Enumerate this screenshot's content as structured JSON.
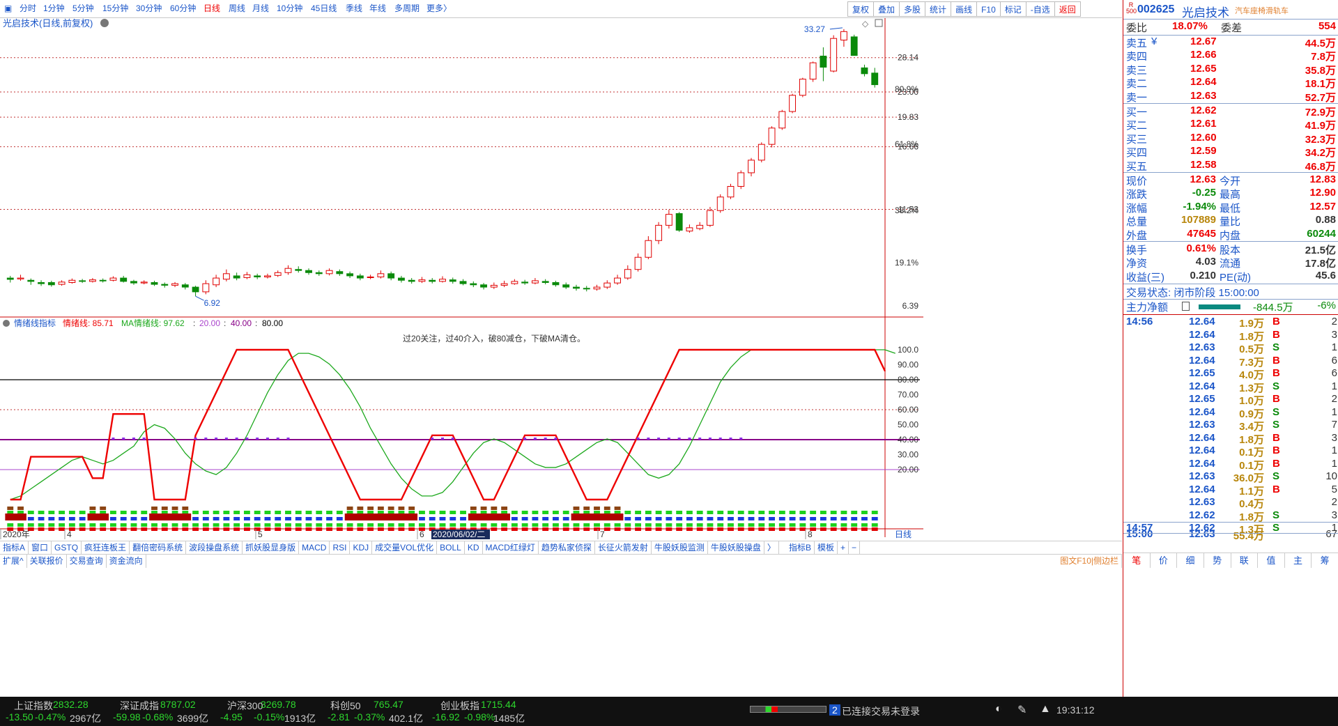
{
  "periods": [
    "分时",
    "1分钟",
    "5分钟",
    "15分钟",
    "30分钟",
    "60分钟",
    "日线",
    "周线",
    "月线",
    "10分钟",
    "45日线",
    "季线",
    "年线",
    "多周期",
    "更多〉"
  ],
  "active_period": "日线",
  "toolbar": [
    "复权",
    "叠加",
    "多股",
    "统计",
    "画线",
    "F10",
    "标记",
    "-自选",
    "返回"
  ],
  "chart_title": "光启技术(日线,前复权)",
  "price_axis": [
    "28.14",
    "23.00",
    "19.83",
    "16.66",
    "11.53",
    "6.39"
  ],
  "pct_axis": [
    "80.9%",
    "61.8%",
    "38.2%",
    "19.1%"
  ],
  "max_label": "33.27",
  "min_label": "6.92",
  "indicator": {
    "name": "情绪线指标",
    "l1": "情绪线: 85.71",
    "l2": "MA情绪线: 97.62",
    "v20": "20.00",
    "v40": "40.00",
    "v80": "80.00",
    "note": "过20关注，过40介入，破80减仓，下破MA清仓。"
  },
  "ind_axis": [
    "100.0",
    "90.00",
    "80.00",
    "70.00",
    "60.00",
    "50.00",
    "40.00",
    "30.00",
    "20.00"
  ],
  "date_axis": [
    "2020年",
    "4",
    "5",
    "6",
    "7",
    "8"
  ],
  "date_cursor": "2020/06/02/二",
  "date_axis_right": "日线",
  "chart_data": {
    "type": "candlestick",
    "max": 33.27,
    "min": 6.92,
    "ylim_price": [
      6.39,
      33.27
    ],
    "candles": [
      {
        "o": 7.7,
        "c": 7.64,
        "h": 7.8,
        "l": 7.5
      },
      {
        "o": 7.66,
        "c": 7.7,
        "h": 7.85,
        "l": 7.58
      },
      {
        "o": 7.6,
        "c": 7.55,
        "h": 7.68,
        "l": 7.4
      },
      {
        "o": 7.5,
        "c": 7.45,
        "h": 7.6,
        "l": 7.35
      },
      {
        "o": 7.5,
        "c": 7.4,
        "h": 7.58,
        "l": 7.32
      },
      {
        "o": 7.42,
        "c": 7.52,
        "h": 7.6,
        "l": 7.36
      },
      {
        "o": 7.5,
        "c": 7.6,
        "h": 7.68,
        "l": 7.45
      },
      {
        "o": 7.58,
        "c": 7.55,
        "h": 7.66,
        "l": 7.48
      },
      {
        "o": 7.55,
        "c": 7.62,
        "h": 7.7,
        "l": 7.5
      },
      {
        "o": 7.6,
        "c": 7.58,
        "h": 7.68,
        "l": 7.5
      },
      {
        "o": 7.6,
        "c": 7.7,
        "h": 7.78,
        "l": 7.55
      },
      {
        "o": 7.7,
        "c": 7.55,
        "h": 7.8,
        "l": 7.5
      },
      {
        "o": 7.55,
        "c": 7.48,
        "h": 7.62,
        "l": 7.4
      },
      {
        "o": 7.48,
        "c": 7.52,
        "h": 7.6,
        "l": 7.42
      },
      {
        "o": 7.5,
        "c": 7.42,
        "h": 7.58,
        "l": 7.35
      },
      {
        "o": 7.42,
        "c": 7.38,
        "h": 7.5,
        "l": 7.28
      },
      {
        "o": 7.38,
        "c": 7.45,
        "h": 7.52,
        "l": 7.3
      },
      {
        "o": 7.4,
        "c": 7.3,
        "h": 7.48,
        "l": 7.2
      },
      {
        "o": 7.3,
        "c": 7.1,
        "h": 7.36,
        "l": 6.92
      },
      {
        "o": 7.1,
        "c": 7.45,
        "h": 7.6,
        "l": 7.0
      },
      {
        "o": 7.4,
        "c": 7.7,
        "h": 7.85,
        "l": 7.3
      },
      {
        "o": 7.65,
        "c": 7.9,
        "h": 8.1,
        "l": 7.55
      },
      {
        "o": 7.8,
        "c": 7.7,
        "h": 7.95,
        "l": 7.6
      },
      {
        "o": 7.72,
        "c": 7.85,
        "h": 7.98,
        "l": 7.65
      },
      {
        "o": 7.8,
        "c": 7.75,
        "h": 7.9,
        "l": 7.65
      },
      {
        "o": 7.75,
        "c": 7.8,
        "h": 7.9,
        "l": 7.68
      },
      {
        "o": 7.82,
        "c": 7.95,
        "h": 8.05,
        "l": 7.75
      },
      {
        "o": 7.95,
        "c": 8.15,
        "h": 8.3,
        "l": 7.85
      },
      {
        "o": 8.1,
        "c": 8.05,
        "h": 8.25,
        "l": 7.95
      },
      {
        "o": 8.05,
        "c": 7.95,
        "h": 8.15,
        "l": 7.85
      },
      {
        "o": 7.95,
        "c": 7.9,
        "h": 8.05,
        "l": 7.8
      },
      {
        "o": 7.9,
        "c": 8.05,
        "h": 8.15,
        "l": 7.82
      },
      {
        "o": 8.0,
        "c": 7.9,
        "h": 8.1,
        "l": 7.8
      },
      {
        "o": 7.9,
        "c": 7.8,
        "h": 8.0,
        "l": 7.7
      },
      {
        "o": 7.8,
        "c": 7.7,
        "h": 7.9,
        "l": 7.6
      },
      {
        "o": 7.72,
        "c": 7.75,
        "h": 7.85,
        "l": 7.65
      },
      {
        "o": 7.75,
        "c": 7.9,
        "h": 8.05,
        "l": 7.68
      },
      {
        "o": 7.9,
        "c": 7.7,
        "h": 8.0,
        "l": 7.6
      },
      {
        "o": 7.7,
        "c": 7.6,
        "h": 7.8,
        "l": 7.5
      },
      {
        "o": 7.6,
        "c": 7.55,
        "h": 7.7,
        "l": 7.45
      },
      {
        "o": 7.55,
        "c": 7.62,
        "h": 7.75,
        "l": 7.48
      },
      {
        "o": 7.6,
        "c": 7.55,
        "h": 7.7,
        "l": 7.46
      },
      {
        "o": 7.55,
        "c": 7.65,
        "h": 7.78,
        "l": 7.5
      },
      {
        "o": 7.62,
        "c": 7.55,
        "h": 7.72,
        "l": 7.45
      },
      {
        "o": 7.55,
        "c": 7.45,
        "h": 7.65,
        "l": 7.38
      },
      {
        "o": 7.45,
        "c": 7.4,
        "h": 7.55,
        "l": 7.3
      },
      {
        "o": 7.4,
        "c": 7.3,
        "h": 7.48,
        "l": 7.2
      },
      {
        "o": 7.3,
        "c": 7.38,
        "h": 7.5,
        "l": 7.22
      },
      {
        "o": 7.38,
        "c": 7.45,
        "h": 7.58,
        "l": 7.3
      },
      {
        "o": 7.45,
        "c": 7.55,
        "h": 7.65,
        "l": 7.4
      },
      {
        "o": 7.52,
        "c": 7.48,
        "h": 7.62,
        "l": 7.4
      },
      {
        "o": 7.48,
        "c": 7.58,
        "h": 7.7,
        "l": 7.42
      },
      {
        "o": 7.55,
        "c": 7.5,
        "h": 7.65,
        "l": 7.42
      },
      {
        "o": 7.5,
        "c": 7.4,
        "h": 7.58,
        "l": 7.32
      },
      {
        "o": 7.4,
        "c": 7.3,
        "h": 7.5,
        "l": 7.22
      },
      {
        "o": 7.3,
        "c": 7.25,
        "h": 7.4,
        "l": 7.15
      },
      {
        "o": 7.25,
        "c": 7.22,
        "h": 7.35,
        "l": 7.12
      },
      {
        "o": 7.22,
        "c": 7.3,
        "h": 7.4,
        "l": 7.15
      },
      {
        "o": 7.3,
        "c": 7.48,
        "h": 7.6,
        "l": 7.22
      },
      {
        "o": 7.48,
        "c": 7.7,
        "h": 7.85,
        "l": 7.4
      },
      {
        "o": 7.7,
        "c": 8.1,
        "h": 8.3,
        "l": 7.62
      },
      {
        "o": 8.1,
        "c": 8.7,
        "h": 8.9,
        "l": 8.0
      },
      {
        "o": 8.7,
        "c": 9.6,
        "h": 9.85,
        "l": 8.6
      },
      {
        "o": 9.6,
        "c": 10.5,
        "h": 10.7,
        "l": 9.4
      },
      {
        "o": 10.5,
        "c": 11.2,
        "h": 11.5,
        "l": 10.3
      },
      {
        "o": 11.25,
        "c": 10.2,
        "h": 11.35,
        "l": 10.1
      },
      {
        "o": 10.15,
        "c": 10.35,
        "h": 10.55,
        "l": 10.05
      },
      {
        "o": 10.3,
        "c": 10.5,
        "h": 10.7,
        "l": 10.2
      },
      {
        "o": 10.5,
        "c": 11.45,
        "h": 11.7,
        "l": 10.4
      },
      {
        "o": 11.45,
        "c": 12.4,
        "h": 12.6,
        "l": 11.3
      },
      {
        "o": 12.4,
        "c": 13.2,
        "h": 13.4,
        "l": 12.25
      },
      {
        "o": 13.2,
        "c": 14.3,
        "h": 14.5,
        "l": 13.0
      },
      {
        "o": 14.3,
        "c": 15.4,
        "h": 15.6,
        "l": 14.0
      },
      {
        "o": 15.4,
        "c": 16.9,
        "h": 17.1,
        "l": 15.2
      },
      {
        "o": 16.9,
        "c": 18.6,
        "h": 18.8,
        "l": 16.6
      },
      {
        "o": 18.6,
        "c": 20.5,
        "h": 20.7,
        "l": 18.4
      },
      {
        "o": 20.5,
        "c": 22.55,
        "h": 22.75,
        "l": 20.3
      },
      {
        "o": 22.55,
        "c": 24.8,
        "h": 25.0,
        "l": 22.3
      },
      {
        "o": 24.8,
        "c": 27.3,
        "h": 27.5,
        "l": 24.4
      },
      {
        "o": 28.4,
        "c": 26.6,
        "h": 29.9,
        "l": 24.5
      },
      {
        "o": 26.0,
        "c": 31.5,
        "h": 32.1,
        "l": 25.8
      },
      {
        "o": 31.2,
        "c": 32.8,
        "h": 33.27,
        "l": 30.0
      },
      {
        "o": 31.8,
        "c": 28.5,
        "h": 32.2,
        "l": 28.5
      },
      {
        "o": 26.5,
        "c": 25.6,
        "h": 27.0,
        "l": 25.2
      },
      {
        "o": 25.7,
        "c": 24.0,
        "h": 26.5,
        "l": 23.6
      }
    ],
    "emotion": [
      0,
      0,
      28.57,
      28.57,
      28.57,
      28.57,
      28.57,
      28.57,
      14.29,
      14.29,
      57.14,
      57.14,
      57.14,
      57.14,
      0,
      0,
      0,
      0,
      42.86,
      57.14,
      71.43,
      85.71,
      100,
      100,
      100,
      100,
      100,
      100,
      85.71,
      71.43,
      57.14,
      42.86,
      28.57,
      14.29,
      0,
      0,
      0,
      0,
      0,
      14.29,
      28.57,
      42.86,
      42.86,
      42.86,
      28.57,
      14.29,
      0,
      0,
      14.29,
      28.57,
      42.86,
      42.86,
      42.86,
      42.86,
      28.57,
      14.29,
      0,
      0,
      0,
      14.29,
      28.57,
      42.86,
      57.14,
      71.43,
      85.71,
      100,
      100,
      100,
      100,
      100,
      100,
      100,
      100,
      100,
      100,
      100,
      100,
      100,
      100,
      100,
      100,
      100,
      100,
      100,
      100,
      85.71
    ],
    "ma_emotion": [
      0,
      2.38,
      7.14,
      11.9,
      16.67,
      21.43,
      26.19,
      28.57,
      26.19,
      23.81,
      26.19,
      30.95,
      35.71,
      45.24,
      50,
      47.62,
      40.48,
      30.95,
      23.81,
      19.05,
      16.67,
      21.43,
      30.95,
      42.86,
      57.14,
      71.43,
      83.33,
      92.86,
      97.62,
      97.62,
      95.24,
      90.48,
      83.33,
      73.81,
      61.9,
      47.62,
      35.71,
      23.81,
      14.29,
      7.14,
      2.38,
      2.38,
      4.76,
      11.9,
      21.43,
      30.95,
      38.1,
      40.48,
      38.1,
      33.33,
      28.57,
      23.81,
      21.43,
      21.43,
      23.81,
      28.57,
      33.33,
      38.1,
      40.48,
      38.1,
      30.95,
      23.81,
      16.67,
      14.29,
      16.67,
      23.81,
      35.71,
      50,
      64.29,
      78.57,
      88.1,
      95.24,
      100,
      100,
      100,
      100,
      100,
      100,
      100,
      100,
      100,
      100,
      100,
      100,
      100,
      100,
      97.62
    ]
  },
  "sub_row1": [
    "指标A",
    "窗口",
    "GSTQ",
    "疯狂连板王",
    "翻倍密码系统",
    "波段操盘系统",
    "抓妖股显身版",
    "MACD",
    "RSI",
    "KDJ",
    "成交量VOL优化",
    "BOLL",
    "KD",
    "MACD红绿灯",
    "趋势私家侦探",
    "长征火箭发射",
    "牛股妖股监测",
    "牛股妖股操盘",
    "〉",
    "指标B",
    "模板",
    "+",
    "−"
  ],
  "sub_row2": [
    "扩展^",
    "关联报价",
    "交易查询",
    "资金流向"
  ],
  "sub_row2_right": "图文F10|侧边栏",
  "rbottom_tabs": [
    "笔",
    "价",
    "细",
    "势",
    "联",
    "值",
    "主",
    "筹"
  ],
  "stock": {
    "badge": "R",
    "badge2": "500",
    "code": "002625",
    "name": "光启技术",
    "tag": "汽车座椅滑轨车"
  },
  "ratio": {
    "label1": "委比",
    "v1": "18.07%",
    "label2": "委差",
    "v2": "554"
  },
  "asks": [
    {
      "l": "卖五",
      "p": "12.67",
      "v": "44.5万"
    },
    {
      "l": "卖四",
      "p": "12.66",
      "v": "7.8万"
    },
    {
      "l": "卖三",
      "p": "12.65",
      "v": "35.8万"
    },
    {
      "l": "卖二",
      "p": "12.64",
      "v": "18.1万"
    },
    {
      "l": "卖一",
      "p": "12.63",
      "v": "52.7万"
    }
  ],
  "ask_symbol": "¥",
  "bids": [
    {
      "l": "买一",
      "p": "12.62",
      "v": "72.9万"
    },
    {
      "l": "买二",
      "p": "12.61",
      "v": "41.9万"
    },
    {
      "l": "买三",
      "p": "12.60",
      "v": "32.3万"
    },
    {
      "l": "买四",
      "p": "12.59",
      "v": "34.2万"
    },
    {
      "l": "买五",
      "p": "12.58",
      "v": "46.8万"
    }
  ],
  "quote": [
    {
      "l1": "现价",
      "v1": "12.63",
      "l2": "今开",
      "v2": "12.83"
    },
    {
      "l1": "涨跌",
      "v1": "-0.25",
      "l2": "最高",
      "v2": "12.90"
    },
    {
      "l1": "涨幅",
      "v1": "-1.94%",
      "l2": "最低",
      "v2": "12.57"
    },
    {
      "l1": "总量",
      "v1": "107889",
      "l2": "量比",
      "v2": "0.88"
    },
    {
      "l1": "外盘",
      "v1": "47645",
      "l2": "内盘",
      "v2": "60244"
    }
  ],
  "quote2": [
    {
      "l1": "换手",
      "v1": "0.61%",
      "l2": "股本",
      "v2": "21.5亿"
    },
    {
      "l1": "净资",
      "v1": "4.03",
      "l2": "流通",
      "v2": "17.8亿"
    },
    {
      "l1": "收益(三)",
      "v1": "0.210",
      "l2": "PE(动)",
      "v2": "45.6"
    }
  ],
  "trade_state": "交易状态: 闭市阶段 15:00:00",
  "main_net": {
    "label": "主力净额",
    "value": "-844.5万",
    "pct": "-6%"
  },
  "ticks": [
    {
      "t": "14:56",
      "p": "12.64",
      "v": "1.9万",
      "s": "B",
      "n": "2"
    },
    {
      "t": "",
      "p": "12.64",
      "v": "1.8万",
      "s": "B",
      "n": "3"
    },
    {
      "t": "",
      "p": "12.63",
      "v": "0.5万",
      "s": "S",
      "n": "1"
    },
    {
      "t": "",
      "p": "12.64",
      "v": "7.3万",
      "s": "B",
      "n": "6"
    },
    {
      "t": "",
      "p": "12.65",
      "v": "4.0万",
      "s": "B",
      "n": "6"
    },
    {
      "t": "",
      "p": "12.64",
      "v": "1.3万",
      "s": "S",
      "n": "1"
    },
    {
      "t": "",
      "p": "12.65",
      "v": "1.0万",
      "s": "B",
      "n": "2"
    },
    {
      "t": "",
      "p": "12.64",
      "v": "0.9万",
      "s": "S",
      "n": "1"
    },
    {
      "t": "",
      "p": "12.63",
      "v": "3.4万",
      "s": "S",
      "n": "7"
    },
    {
      "t": "",
      "p": "12.64",
      "v": "1.8万",
      "s": "B",
      "n": "3"
    },
    {
      "t": "",
      "p": "12.64",
      "v": "0.1万",
      "s": "B",
      "n": "1"
    },
    {
      "t": "",
      "p": "12.64",
      "v": "0.1万",
      "s": "B",
      "n": "1"
    },
    {
      "t": "",
      "p": "12.63",
      "v": "36.0万",
      "s": "S",
      "n": "10"
    },
    {
      "t": "",
      "p": "12.64",
      "v": "1.1万",
      "s": "B",
      "n": "5"
    },
    {
      "t": "",
      "p": "12.63",
      "v": "0.4万",
      "s": "",
      "n": "2"
    },
    {
      "t": "",
      "p": "12.62",
      "v": "1.8万",
      "s": "S",
      "n": "3"
    },
    {
      "t": "14:57",
      "p": "12.62",
      "v": "1.3万",
      "s": "S",
      "n": "1"
    },
    {
      "t": "15:00",
      "p": "12.63",
      "v": "55.4万",
      "s": "",
      "n": "67"
    }
  ],
  "status": {
    "i1": {
      "name": "上证指数",
      "v": "2832.28",
      "c": "-13.50",
      "pc": "-0.47%",
      "amt": "2967亿"
    },
    "i2": {
      "name": "深证成指",
      "v": "8787.02",
      "c": "-59.98",
      "pc": "-0.68%",
      "amt": "3699亿"
    },
    "i3": {
      "name": "沪深300",
      "v": "3269.78",
      "c": "-4.95",
      "pc": "-0.15%",
      "amt": "1913亿"
    },
    "i4": {
      "name": "科创50",
      "v": "765.47",
      "c": "-2.81",
      "pc": "-0.37%",
      "amt": "402.1亿"
    },
    "i5": {
      "name": "创业板指",
      "v": "1715.44",
      "c": "-16.92",
      "pc": "-0.98%",
      "amt": "1485亿"
    },
    "conn_num": "2",
    "conn": "已连接",
    "login": "交易未登录",
    "time": "19:31:12"
  },
  "colors": {
    "up": "#e00000",
    "down": "#0a8a0a",
    "ma": "#1ca81c",
    "emotion": "#ee0000",
    "line40": "#880088",
    "line20": "#aa44cc",
    "line80": "#000000"
  }
}
